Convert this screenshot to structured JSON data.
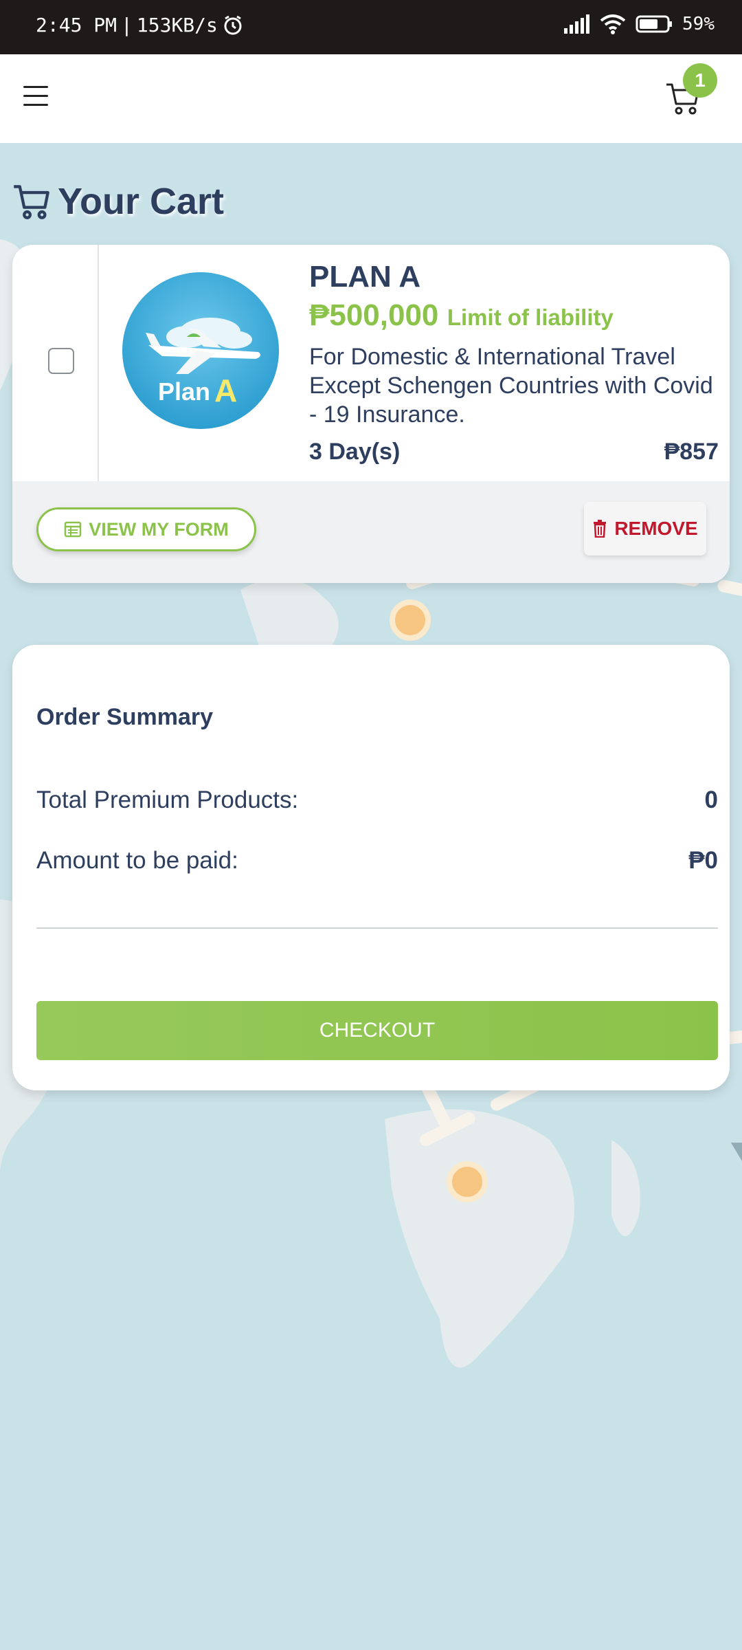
{
  "status_bar": {
    "time": "2:45 PM",
    "separator": "|",
    "speed": "153KB/s",
    "battery": "59%",
    "icons": [
      "alarm-icon",
      "signal-icon",
      "wifi-icon",
      "battery-icon"
    ]
  },
  "header": {
    "cart_count": "1",
    "icons": [
      "hamburger-menu-icon",
      "cart-icon"
    ]
  },
  "page": {
    "title": "Your Cart"
  },
  "cart_item": {
    "image_label_plan": "Plan",
    "image_label_letter": "A",
    "name": "PLAN A",
    "limit_amount": "₱500,000",
    "limit_label": "Limit of liability",
    "description": "For Domestic & International Travel Except Schengen Countries with Covid - 19 Insurance.",
    "duration": "3 Day(s)",
    "price": "₱857",
    "view_form_label": "VIEW MY FORM",
    "remove_label": "REMOVE"
  },
  "order_summary": {
    "title": "Order Summary",
    "rows": [
      {
        "label": "Total Premium Products:",
        "value": "0"
      },
      {
        "label": "Amount to be paid:",
        "value": "₱0"
      }
    ],
    "checkout_label": "CHECKOUT"
  },
  "colors": {
    "accent_green": "#8bc34a",
    "text_navy": "#2d3e5e",
    "remove_red": "#c0182c",
    "status_bar_bg": "#1f1a1a",
    "background_map": "#c9e2e8"
  }
}
